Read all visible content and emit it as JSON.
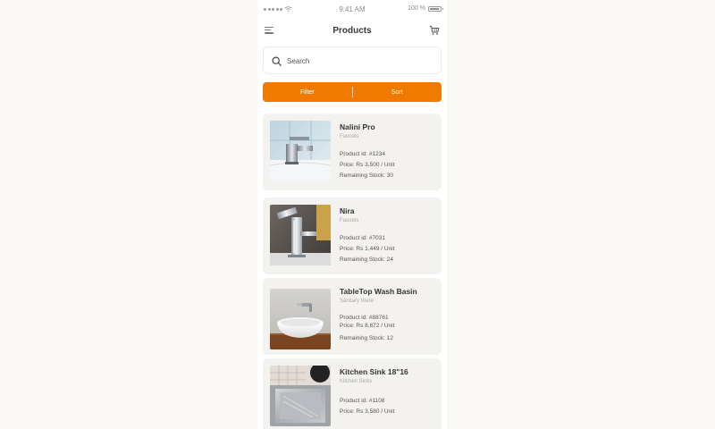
{
  "status_bar": {
    "time": "9:41 AM",
    "battery": "100 %"
  },
  "header": {
    "title": "Products"
  },
  "search": {
    "placeholder": "Search"
  },
  "actions": {
    "filter_label": "Filter",
    "sort_label": "Sort"
  },
  "products": [
    {
      "name": "Nalini Pro",
      "category": "Faucets",
      "product_id": "Product id: #1234",
      "price": "Price: Rs 3,500 / Unit",
      "stock": "Remaining Stock: 30"
    },
    {
      "name": "Nira",
      "category": "Faucets",
      "product_id": "Product id: #7031",
      "price": "Price: Rs 1,449 / Unit",
      "stock": "Remaining Stock: 24"
    },
    {
      "name": "TableTop Wash Basin",
      "category": "Sanitary Ware",
      "product_id": "Product id: #88761",
      "price": "Price: Rs 8,672 / Unit",
      "stock": "Remaining Stock: 12"
    },
    {
      "name": "Kitchen Sink 18\"16",
      "category": "Kitchen Sinks",
      "product_id": "Product id: #1108",
      "price": "Price: Rs 3,580 / Unit",
      "stock": ""
    }
  ],
  "icons": {
    "menu": "menu-icon",
    "cart": "cart-icon",
    "search": "search-icon",
    "wifi": "wifi-icon",
    "battery": "battery-icon"
  },
  "colors": {
    "accent": "#f07a00",
    "card_bg": "#f4f2ef",
    "page_bg": "#faf8f4"
  }
}
